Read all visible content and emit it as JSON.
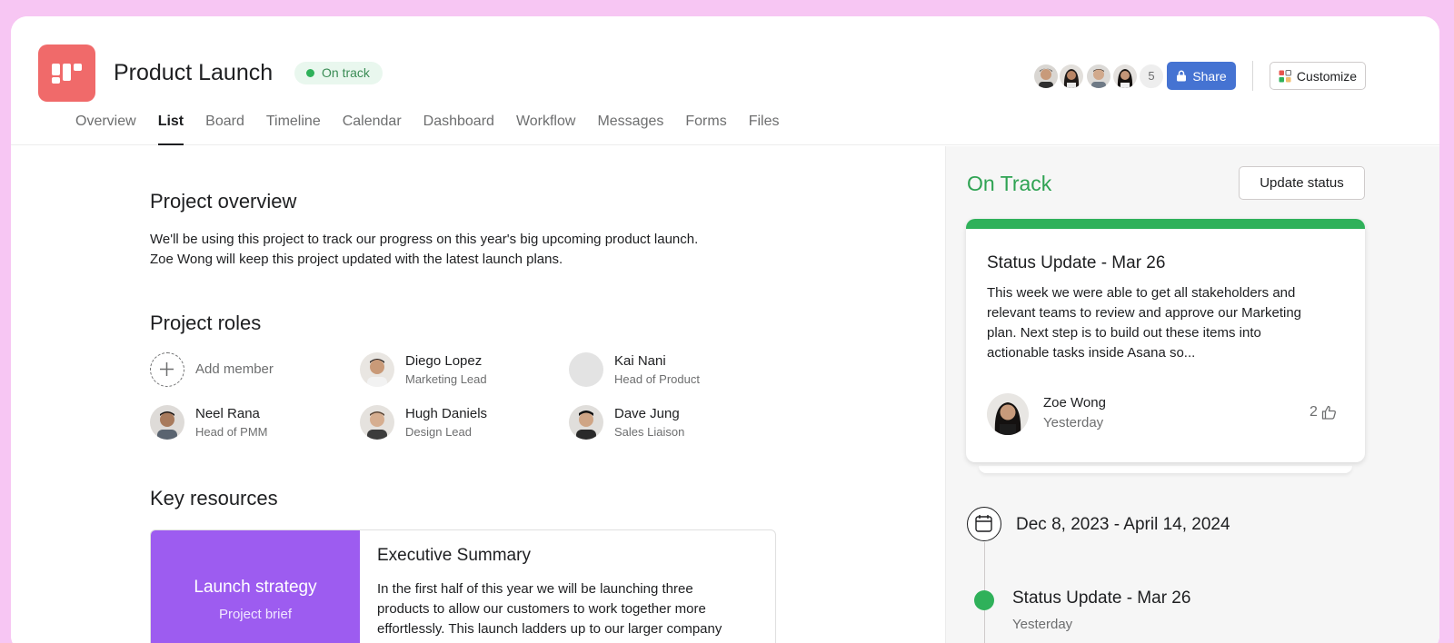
{
  "project": {
    "title": "Product Launch",
    "status_pill": "On track"
  },
  "header": {
    "member_count": "5",
    "share_label": "Share",
    "customize_label": "Customize"
  },
  "tabs": [
    {
      "label": "Overview"
    },
    {
      "label": "List"
    },
    {
      "label": "Board"
    },
    {
      "label": "Timeline"
    },
    {
      "label": "Calendar"
    },
    {
      "label": "Dashboard"
    },
    {
      "label": "Workflow"
    },
    {
      "label": "Messages"
    },
    {
      "label": "Forms"
    },
    {
      "label": "Files"
    }
  ],
  "active_tab": "List",
  "overview": {
    "heading": "Project overview",
    "description_line1": "We'll be using this project to track our progress on this year's big upcoming product launch.",
    "description_line2": "Zoe Wong will keep this project updated with the latest launch plans."
  },
  "roles": {
    "heading": "Project roles",
    "add_member": "Add member",
    "members": [
      {
        "name": "Diego Lopez",
        "title": "Marketing Lead"
      },
      {
        "name": "Kai Nani",
        "title": "Head of Product"
      },
      {
        "name": "Neel Rana",
        "title": "Head of PMM"
      },
      {
        "name": "Hugh Daniels",
        "title": "Design Lead"
      },
      {
        "name": "Dave Jung",
        "title": "Sales Liaison"
      }
    ]
  },
  "resources": {
    "heading": "Key resources",
    "card": {
      "thumb_title": "Launch strategy",
      "thumb_subtitle": "Project brief",
      "title": "Executive Summary",
      "body_line1": "In the first half of this year we will be launching three",
      "body_line2": "products to allow our customers to work together more",
      "body_line3": "effortlessly. This launch ladders up to our larger company"
    }
  },
  "side": {
    "status_heading": "On Track",
    "update_button": "Update status",
    "status_card": {
      "title": "Status Update - Mar 26",
      "body_line1": "This week we were able to get all stakeholders and",
      "body_line2": "relevant teams to review and approve our Marketing",
      "body_line3": "plan. Next step is to build out these items into",
      "body_line4": "actionable tasks inside Asana so...",
      "author": "Zoe Wong",
      "time": "Yesterday",
      "likes": "2"
    },
    "date_range": "Dec 8, 2023 - April 14, 2024",
    "timeline": {
      "title": "Status Update - Mar 26",
      "time": "Yesterday"
    }
  },
  "colors": {
    "brand": "#f06a6a",
    "share": "#4573d2",
    "on_track": "#2fb15a",
    "resource_thumb": "#9d5cf0",
    "background": "#f7c6f3"
  }
}
